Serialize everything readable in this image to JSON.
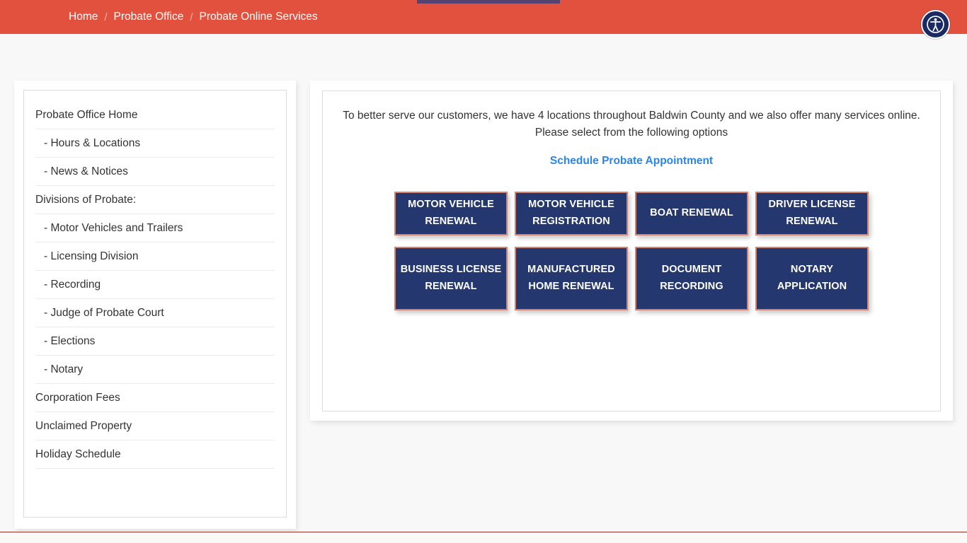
{
  "breadcrumb": {
    "separator": "/",
    "items": [
      {
        "label": "Home",
        "current": false
      },
      {
        "label": "Probate Office",
        "current": false
      },
      {
        "label": "Probate Online Services",
        "current": true
      }
    ]
  },
  "accessibility_widget": {
    "icon": "accessibility-person-icon",
    "label": "Accessibility Options"
  },
  "sidebar": {
    "items": [
      {
        "label": "Probate Office Home",
        "child": false
      },
      {
        "label": "- Hours & Locations",
        "child": true
      },
      {
        "label": "- News & Notices",
        "child": true
      },
      {
        "label": "Divisions of Probate:",
        "child": false
      },
      {
        "label": "- Motor Vehicles and Trailers",
        "child": true
      },
      {
        "label": "- Licensing Division",
        "child": true
      },
      {
        "label": "- Recording",
        "child": true
      },
      {
        "label": "- Judge of Probate Court",
        "child": true
      },
      {
        "label": "- Elections",
        "child": true
      },
      {
        "label": "- Notary",
        "child": true
      },
      {
        "label": "Corporation Fees",
        "child": false
      },
      {
        "label": "Unclaimed Property",
        "child": false
      },
      {
        "label": "Holiday Schedule",
        "child": false
      }
    ]
  },
  "main": {
    "intro_line_1": "To better serve our customers, we have 4 locations throughout Baldwin County and we also offer many services online.",
    "intro_line_2": "Please select from the following options",
    "appointment_link": "Schedule Probate Appointment",
    "buttons_row_1": [
      {
        "label": "MOTOR VEHICLE RENEWAL"
      },
      {
        "label": "MOTOR VEHICLE REGISTRATION"
      },
      {
        "label": "BOAT RENEWAL"
      },
      {
        "label": "DRIVER LICENSE RENEWAL"
      }
    ],
    "buttons_row_2": [
      {
        "label": "BUSINESS LICENSE RENEWAL"
      },
      {
        "label": "MANUFACTURED HOME RENEWAL"
      },
      {
        "label": "DOCUMENT RECORDING"
      },
      {
        "label": "NOTARY APPLICATION"
      }
    ]
  },
  "colors": {
    "breadcrumb_bar": "#e2513e",
    "button_fill": "#24376e",
    "button_border": "#d4836f",
    "link_blue": "#2b84e8",
    "page_background": "#f8f8f8",
    "bottom_rule": "#9b3024"
  }
}
